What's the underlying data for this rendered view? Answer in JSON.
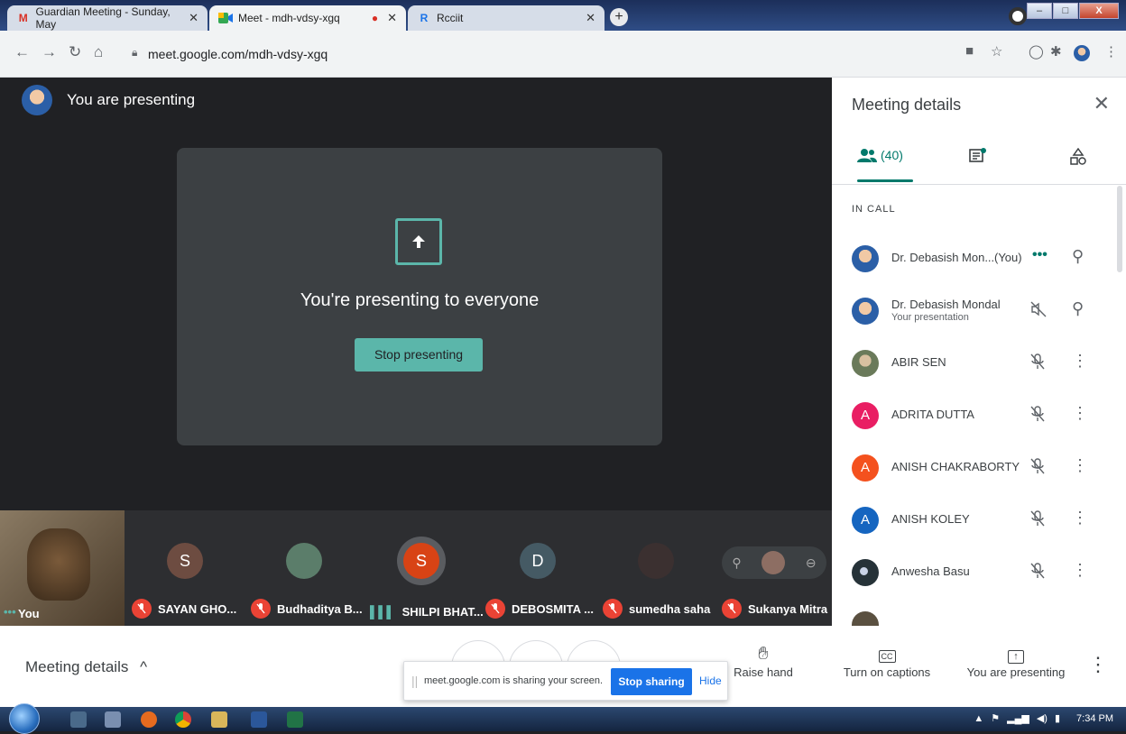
{
  "browser": {
    "tabs": [
      {
        "title": "Guardian Meeting - Sunday, May",
        "favicon": "gmail-icon"
      },
      {
        "title": "Meet - mdh-vdsy-xgq",
        "favicon": "meet-icon",
        "recording": true
      },
      {
        "title": "Rcciit",
        "favicon": "site-icon"
      }
    ],
    "url": "meet.google.com/mdh-vdsy-xgq"
  },
  "stage": {
    "presenting_label": "You are presenting",
    "card_title": "You're presenting to everyone",
    "stop_button": "Stop presenting"
  },
  "tiles": {
    "self_label": "You",
    "participants": [
      {
        "initial": "S",
        "name": "SAYAN GHO...",
        "color": "#6d4c41",
        "muted": true
      },
      {
        "initial": "",
        "name": "Budhaditya B...",
        "color": "#5b7d6a",
        "muted": true
      },
      {
        "initial": "S",
        "name": "SHILPI BHAT...",
        "color": "#d84315",
        "muted": false
      },
      {
        "initial": "D",
        "name": "DEBOSMITA ...",
        "color": "#455a64",
        "muted": true
      },
      {
        "initial": "",
        "name": "sumedha saha",
        "color": "#3b3030",
        "muted": true
      },
      {
        "initial": "",
        "name": "Sukanya Mitra",
        "color": "#8d6e63",
        "muted": true
      }
    ]
  },
  "panel": {
    "title": "Meeting details",
    "people_count": "(40)",
    "section": "IN CALL",
    "people": [
      {
        "name": "Dr. Debasish Mon...",
        "you": "(You)",
        "initial": "",
        "color": "#2b5fa7",
        "status": "speaking"
      },
      {
        "name": "Dr. Debasish Mondal",
        "sub": "Your presentation",
        "initial": "",
        "color": "#2b5fa7",
        "status": "presenting"
      },
      {
        "name": "ABIR SEN",
        "initial": "",
        "color": "#6a7a5a",
        "status": "muted"
      },
      {
        "name": "ADRITA DUTTA",
        "initial": "A",
        "color": "#e91e63",
        "status": "muted"
      },
      {
        "name": "ANISH CHAKRABORTY",
        "initial": "A",
        "color": "#f4511e",
        "status": "muted"
      },
      {
        "name": "ANISH KOLEY",
        "initial": "A",
        "color": "#1565c0",
        "status": "muted"
      },
      {
        "name": "Anwesha Basu",
        "initial": "",
        "color": "#263238",
        "status": "muted"
      }
    ]
  },
  "bottom": {
    "meeting_details": "Meeting details",
    "raise_hand": "Raise hand",
    "captions": "Turn on captions",
    "presenting": "You are presenting"
  },
  "share_bar": {
    "text": "meet.google.com is sharing your screen.",
    "stop": "Stop sharing",
    "hide": "Hide"
  },
  "taskbar": {
    "time": "7:34 PM"
  }
}
